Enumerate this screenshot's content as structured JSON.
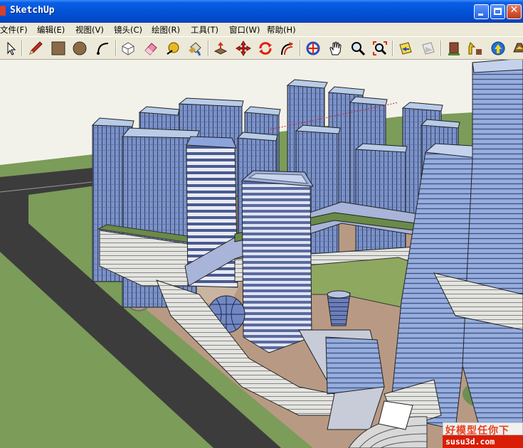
{
  "window": {
    "title": "SketchUp"
  },
  "menu": [
    {
      "label": "文件(F)"
    },
    {
      "label": "编辑(E)"
    },
    {
      "label": "视图(V)"
    },
    {
      "label": "镜头(C)"
    },
    {
      "label": "绘图(R)"
    },
    {
      "label": "工具(T)"
    },
    {
      "label": "窗口(W)"
    },
    {
      "label": "帮助(H)"
    }
  ],
  "toolbar": [
    {
      "icon": "select-arrow-icon"
    },
    {
      "icon": "line-pencil-icon"
    },
    {
      "icon": "rectangle-icon"
    },
    {
      "icon": "circle-icon"
    },
    {
      "icon": "arc-icon"
    },
    {
      "icon": "make-component-icon"
    },
    {
      "icon": "eraser-icon"
    },
    {
      "icon": "tape-measure-icon"
    },
    {
      "icon": "paint-bucket-icon"
    },
    {
      "icon": "push-pull-icon"
    },
    {
      "icon": "move-icon"
    },
    {
      "icon": "rotate-icon"
    },
    {
      "icon": "offset-icon"
    },
    {
      "icon": "orbit-icon"
    },
    {
      "icon": "pan-hand-icon"
    },
    {
      "icon": "zoom-icon"
    },
    {
      "icon": "zoom-extents-icon"
    },
    {
      "icon": "previous-view-icon"
    },
    {
      "icon": "next-view-icon"
    },
    {
      "icon": "add-location-icon"
    },
    {
      "icon": "get-models-icon"
    },
    {
      "icon": "share-model-icon"
    },
    {
      "icon": "google-earth-icon"
    }
  ],
  "watermark": {
    "line1": "好模型任你下",
    "line2": "susu3d.com"
  },
  "colors": {
    "titlebar": "#0453d8",
    "chrome": "#ece9d8",
    "ground": "#7a9a58",
    "road": "#3c3c3c",
    "glass": "#8aa4d8",
    "roof": "#b8cce8"
  }
}
